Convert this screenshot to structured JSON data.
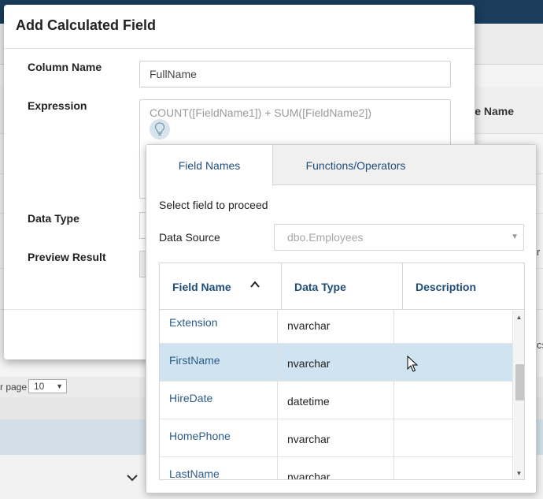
{
  "background": {
    "column_header": "rce Name",
    "pager_label": "r page",
    "pager_value": "10",
    "side_texts": [
      "r",
      "cs"
    ]
  },
  "dialog": {
    "title": "Add Calculated Field",
    "column_name_label": "Column Name",
    "column_name_value": "FullName",
    "expression_label": "Expression",
    "expression_placeholder": "COUNT([FieldName1]) + SUM([FieldName2])",
    "data_type_label": "Data Type",
    "preview_result_label": "Preview Result"
  },
  "popup": {
    "tabs": [
      "Field Names",
      "Functions/Operators"
    ],
    "active_tab": "Field Names",
    "hint": "Select field to proceed",
    "data_source_label": "Data Source",
    "data_source_value": "dbo.Employees",
    "columns": [
      "Field Name",
      "Data Type",
      "Description"
    ],
    "sort": {
      "column": "Field Name",
      "direction": "ascending"
    },
    "rows": [
      {
        "name": "Extension",
        "type": "nvarchar",
        "description": ""
      },
      {
        "name": "FirstName",
        "type": "nvarchar",
        "description": "",
        "selected": true
      },
      {
        "name": "HireDate",
        "type": "datetime",
        "description": ""
      },
      {
        "name": "HomePhone",
        "type": "nvarchar",
        "description": ""
      },
      {
        "name": "LastName",
        "type": "nvarchar",
        "description": ""
      }
    ]
  },
  "colors": {
    "accent": "#1f4d7a",
    "link": "#2c5d8a",
    "selected_row": "#cfe3f0",
    "top_bar": "#1a3d5c"
  },
  "icons": [
    "lightbulb-icon",
    "sort-ascending-icon",
    "dropdown-caret-icon",
    "scroll-up-icon",
    "scroll-down-icon",
    "mouse-cursor-icon",
    "chevron-down-icon"
  ]
}
